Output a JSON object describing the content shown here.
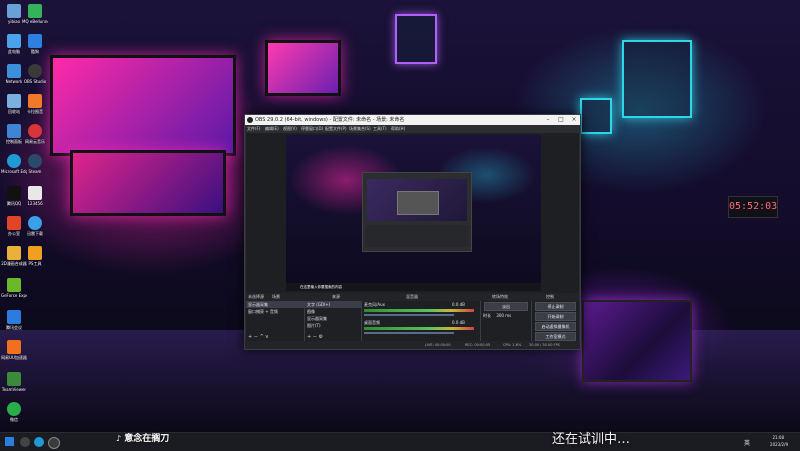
{
  "desktop": {
    "icons": [
      {
        "label": "yibiao",
        "color": "#6aa0d8"
      },
      {
        "label": "MQ eBellunner",
        "color": "#35b35a"
      },
      {
        "label": "此电脑",
        "color": "#4aa3e8"
      },
      {
        "label": "酷狗",
        "color": "#2e7fe0"
      },
      {
        "label": "Network",
        "color": "#3c8fd8"
      },
      {
        "label": "OBS Studio",
        "color": "#3a3a3a"
      },
      {
        "label": "回收站",
        "color": "#7ab0e0"
      },
      {
        "label": "卡拉图音",
        "color": "#f07a2a"
      },
      {
        "label": "控制面板",
        "color": "#3e86d4"
      },
      {
        "label": "网易云音乐",
        "color": "#d8343a"
      },
      {
        "label": "Microsoft Edge",
        "color": "#1f9ad6"
      },
      {
        "label": "Steam",
        "color": "#2a4a6a"
      },
      {
        "label": "腾讯QQ",
        "color": "#111111"
      },
      {
        "label": "123456",
        "color": "#e8e8e8"
      },
      {
        "label": "办公室",
        "color": "#e0452a"
      },
      {
        "label": "迅雷下载",
        "color": "#3aa0e8"
      },
      {
        "label": "2D漫画合成器",
        "color": "#e8b23a"
      },
      {
        "label": "PS工具",
        "color": "#f0a020"
      },
      {
        "label": "GeForce Experience",
        "color": "#6bb82a"
      },
      {
        "label": "腾讯会议",
        "color": "#2c7ce0"
      },
      {
        "label": "网易UU加速器",
        "color": "#f07020"
      },
      {
        "label": "TeamViewer",
        "color": "#3a8a3a"
      },
      {
        "label": "微信",
        "color": "#2aae4a"
      }
    ],
    "neon_clock": "05:52:03",
    "accent_pink": "#ff28b4",
    "accent_cyan": "#2fd6e8"
  },
  "obs": {
    "title": "OBS 29.0.2 (64-bit, windows) - 配置文件: 未命名 - 场景: 未命名",
    "menu": [
      "文件(F)",
      "编辑(E)",
      "视图(V)",
      "停靠窗口(D)",
      "配置文件(P)",
      "场景集合(S)",
      "工具(T)",
      "帮助(H)"
    ],
    "preview": {
      "task_text": "在这里输入你要搜索的内容"
    },
    "dock_headers": {
      "scenes": "场景",
      "sources": "来源",
      "mixer": "混音器",
      "transitions": "转场特效",
      "controls": "控制"
    },
    "source_status": "未选择源",
    "scenes": [
      "显示器采集",
      "窗口捕获 + 音频"
    ],
    "sources": [
      "文字 (GDI+)",
      "图像",
      "显示器采集",
      "图片(T)"
    ],
    "mixer": {
      "channels": [
        {
          "name": "麦克风/Aux",
          "level": "0.0 dB"
        },
        {
          "name": "桌面音频",
          "level": "0.0 dB"
        }
      ]
    },
    "transitions": {
      "type": "淡出",
      "duration_label": "时长",
      "duration": "300 ms"
    },
    "controls": [
      "停止录制",
      "开始录制",
      "启动虚拟摄像机",
      "工作室模式",
      "设置",
      "退出"
    ],
    "status": {
      "live": "LIVE: 00:00:00",
      "rec": "REC: 00:00:05",
      "cpu": "CPU: 1.6%",
      "fps": "30.00 / 30.00 FPS"
    }
  },
  "taskbar": {
    "overlay": "意念在搁刀",
    "time": "21:08",
    "date": "2023/2/9",
    "lang": "英"
  },
  "subtitle": "还在试训中…"
}
